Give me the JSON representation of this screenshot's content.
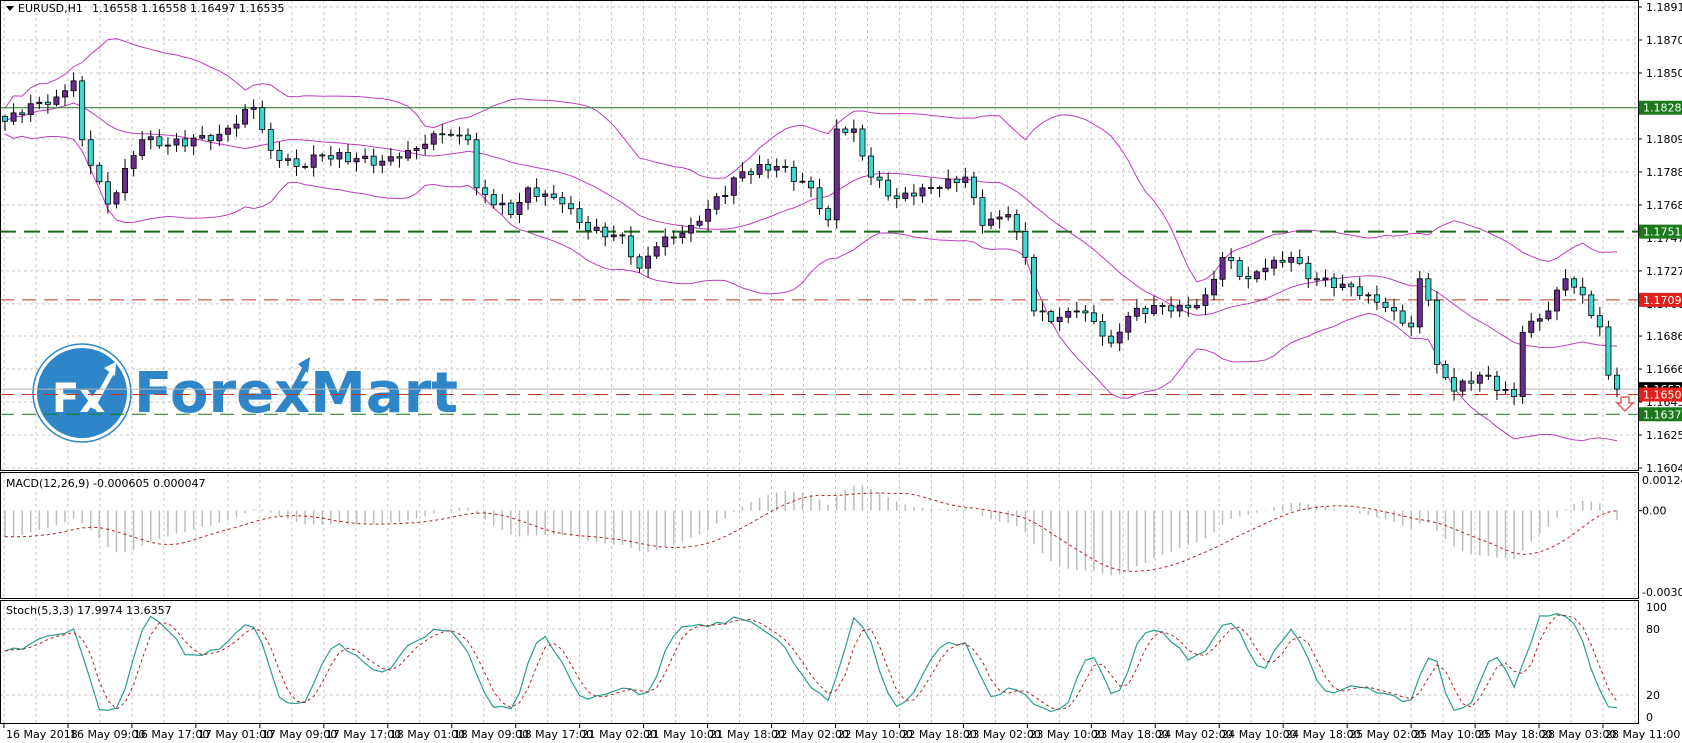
{
  "header": {
    "symbol": "EURUSD,H1",
    "ohlc": "1.16558 1.16558 1.16497 1.16535"
  },
  "logo": {
    "text": "ForexMart",
    "mark": "Fx"
  },
  "colors": {
    "bull": "#6a2c8f",
    "bear": "#3fd6d0",
    "bands": "#c03cc0",
    "macd_hist": "#bdbdbd",
    "signal": "#b22222",
    "stoch_main": "#2a9d90",
    "green": "#1a7a1a",
    "red": "#e0201b"
  },
  "chart_data": {
    "type": "candlestick",
    "title": "EURUSD,H1",
    "ylim": [
      1.16045,
      1.1891
    ],
    "bar_count": 189,
    "close_waypoints": [
      [
        0,
        1.182
      ],
      [
        1,
        1.18252
      ],
      [
        6,
        1.18351
      ],
      [
        8,
        1.18451
      ],
      [
        9,
        1.18085
      ],
      [
        12,
        1.17686
      ],
      [
        16,
        1.18085
      ],
      [
        19,
        1.18052
      ],
      [
        25,
        1.18119
      ],
      [
        29,
        1.18285
      ],
      [
        31,
        1.18019
      ],
      [
        34,
        1.17919
      ],
      [
        37,
        1.17986
      ],
      [
        44,
        1.17952
      ],
      [
        47,
        1.18019
      ],
      [
        51,
        1.18119
      ],
      [
        54,
        1.18085
      ],
      [
        55,
        1.17786
      ],
      [
        59,
        1.1762
      ],
      [
        61,
        1.17786
      ],
      [
        65,
        1.17687
      ],
      [
        68,
        1.1752
      ],
      [
        72,
        1.17487
      ],
      [
        74,
        1.17287
      ],
      [
        76,
        1.1742
      ],
      [
        80,
        1.17553
      ],
      [
        82,
        1.17653
      ],
      [
        86,
        1.17886
      ],
      [
        90,
        1.17919
      ],
      [
        94,
        1.17786
      ],
      [
        96,
        1.17587
      ],
      [
        97,
        1.18152
      ],
      [
        99,
        1.18152
      ],
      [
        101,
        1.17853
      ],
      [
        104,
        1.1772
      ],
      [
        107,
        1.17786
      ],
      [
        111,
        1.17819
      ],
      [
        112,
        1.17853
      ],
      [
        114,
        1.17553
      ],
      [
        117,
        1.1762
      ],
      [
        119,
        1.17354
      ],
      [
        120,
        1.17021
      ],
      [
        122,
        1.16955
      ],
      [
        125,
        1.17021
      ],
      [
        127,
        1.16955
      ],
      [
        129,
        1.16822
      ],
      [
        131,
        1.16988
      ],
      [
        134,
        1.17055
      ],
      [
        136,
        1.17021
      ],
      [
        139,
        1.17055
      ],
      [
        140,
        1.17121
      ],
      [
        142,
        1.17354
      ],
      [
        145,
        1.17221
      ],
      [
        147,
        1.17287
      ],
      [
        150,
        1.17354
      ],
      [
        152,
        1.17221
      ],
      [
        156,
        1.17188
      ],
      [
        159,
        1.17121
      ],
      [
        162,
        1.17021
      ],
      [
        164,
        1.16922
      ],
      [
        165,
        1.17221
      ],
      [
        166,
        1.17088
      ],
      [
        167,
        1.16689
      ],
      [
        169,
        1.16523
      ],
      [
        172,
        1.16622
      ],
      [
        176,
        1.16489
      ],
      [
        177,
        1.16888
      ],
      [
        180,
        1.17021
      ],
      [
        182,
        1.17221
      ],
      [
        184,
        1.17121
      ],
      [
        186,
        1.16922
      ],
      [
        187,
        1.16622
      ],
      [
        188,
        1.16535
      ]
    ],
    "price_ticks": [
      "1.18910",
      "1.18705",
      "1.18500",
      "1.18090",
      "1.17885",
      "1.17680",
      "1.17475",
      "1.17270",
      "1.17065",
      "1.16865",
      "1.16660",
      "1.16455",
      "1.16250",
      "1.16045"
    ],
    "levels": [
      {
        "price": 1.18284,
        "label": "1.18284",
        "color": "#1a7a1a",
        "style": "solid"
      },
      {
        "price": 1.17514,
        "label": "1.17514",
        "color": "#1a6a1a",
        "style": "dashed-thick"
      },
      {
        "price": 1.1709,
        "label": "1.17090",
        "color": "#c0392b",
        "style": "dashed"
      },
      {
        "price": 1.16535,
        "label": "1.16535",
        "color": "#000000",
        "style": "current"
      },
      {
        "price": 1.16502,
        "label": "1.16502",
        "color": "#c0392b",
        "style": "dashed"
      },
      {
        "price": 1.16379,
        "label": "1.16379",
        "color": "#1a7a1a",
        "style": "dashed"
      }
    ],
    "time_labels": [
      "16 May 2018",
      "16 May 09:00",
      "16 May 17:00",
      "17 May 01:00",
      "17 May 09:00",
      "17 May 17:00",
      "18 May 01:00",
      "18 May 09:00",
      "18 May 17:00",
      "21 May 02:00",
      "21 May 10:00",
      "21 May 18:00",
      "22 May 02:00",
      "22 May 10:00",
      "22 May 18:00",
      "23 May 02:00",
      "23 May 10:00",
      "23 May 18:00",
      "24 May 02:00",
      "24 May 10:00",
      "24 May 18:00",
      "25 May 02:00",
      "25 May 10:00",
      "25 May 18:00",
      "28 May 03:00",
      "28 May 11:00"
    ],
    "indicators": {
      "bollinger": {
        "period": 20,
        "deviation": 2
      },
      "macd": {
        "label": "MACD(12,26,9) -0.000605 0.000047",
        "ylim": [
          -0.003057,
          0.001242
        ],
        "ticks": [
          "0.001242",
          "0.00",
          "-0.003057"
        ]
      },
      "stoch": {
        "label": "Stoch(5,3,3) 17.9974 13.6357",
        "ylim": [
          0,
          100
        ],
        "ticks": [
          "100",
          "80",
          "20",
          "0"
        ]
      }
    }
  }
}
